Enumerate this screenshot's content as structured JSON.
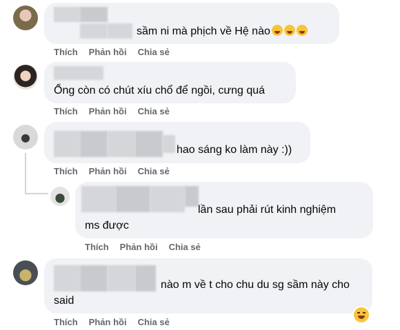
{
  "actions": {
    "like": "Thích",
    "reply": "Phản hồi",
    "share": "Chia sẻ"
  },
  "comments": [
    {
      "text": "sầm ni mà phịch về Hệ nào",
      "emoji": [
        "rofl-emoji",
        "rofl-emoji",
        "rofl-emoji"
      ]
    },
    {
      "text": "Ổng còn có chút xíu chổ để ngồi, cưng quá"
    },
    {
      "text": "hao sáng ko làm này :))"
    },
    {
      "line1": "lần sau phải rút kinh nghiệm",
      "line2": "ms được"
    },
    {
      "line1": "nào m về t cho chu du sg sầm này cho",
      "line2": "said",
      "reaction": "laughing-emoji"
    }
  ]
}
